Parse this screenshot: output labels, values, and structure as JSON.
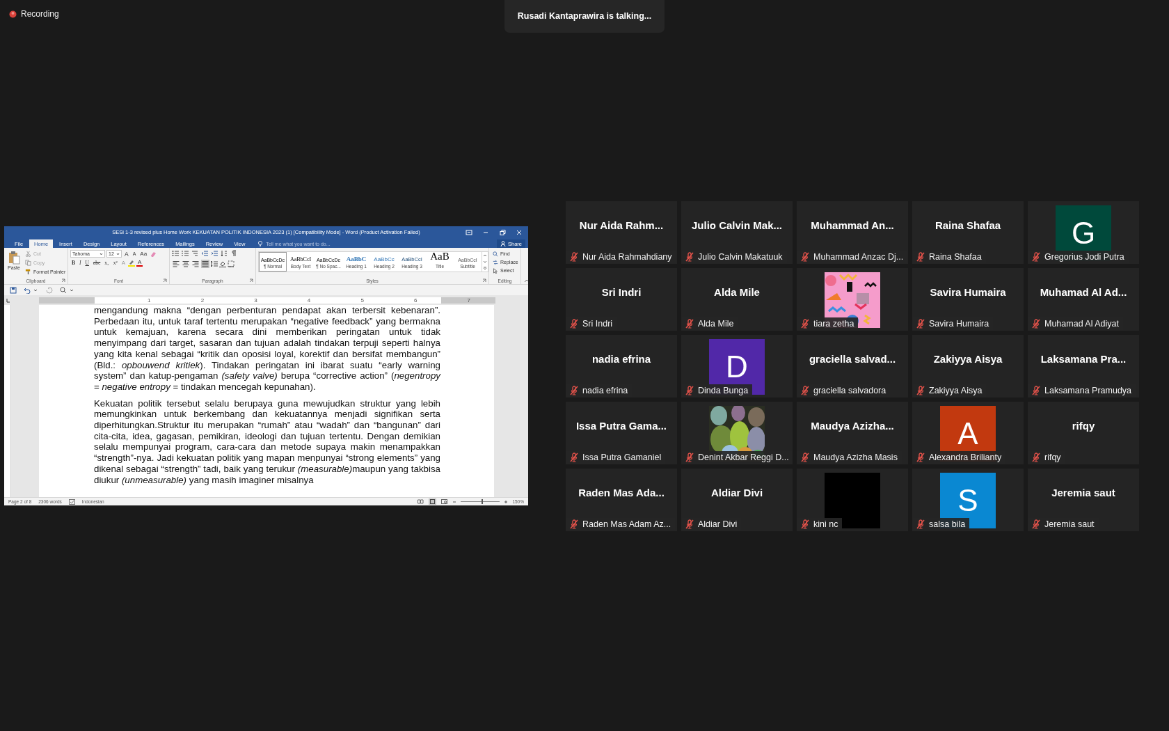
{
  "recording": {
    "label": "Recording"
  },
  "speaker_banner": {
    "text": "Rusadi Kantaprawira is talking..."
  },
  "shared_window": {
    "title": "SESi 1-3 revised plus Home Work  KEKUATAN POLITIK INDONESIA 2023 (1) [Compatibility Mode] - Word (Product Activation Failed)",
    "tabs": [
      {
        "label": "File",
        "selected": false
      },
      {
        "label": "Home",
        "selected": true
      },
      {
        "label": "Insert",
        "selected": false
      },
      {
        "label": "Design",
        "selected": false
      },
      {
        "label": "Layout",
        "selected": false
      },
      {
        "label": "References",
        "selected": false
      },
      {
        "label": "Mailings",
        "selected": false
      },
      {
        "label": "Review",
        "selected": false
      },
      {
        "label": "View",
        "selected": false
      }
    ],
    "tell_me": {
      "placeholder": "Tell me what you want to do..."
    },
    "share_button": "Share",
    "clipboard": {
      "label": "Clipboard",
      "paste": "Paste",
      "items": [
        {
          "kind": "cut",
          "label": "Cut",
          "disabled": true
        },
        {
          "kind": "copy",
          "label": "Copy",
          "disabled": true
        },
        {
          "kind": "painter",
          "label": "Format Painter",
          "disabled": false
        }
      ]
    },
    "font": {
      "label": "Font",
      "name": "Tahoma",
      "size": "12",
      "size_buttons": [
        "A",
        "A"
      ],
      "case_button": "Aa",
      "formats": [
        "B",
        "I",
        "U",
        "abc",
        "x₂",
        "x²"
      ],
      "effects_button": "A",
      "color_button": "A"
    },
    "paragraph": {
      "label": "Paragraph",
      "alignments": [
        {
          "kind": "left",
          "selected": false
        },
        {
          "kind": "center",
          "selected": false
        },
        {
          "kind": "right",
          "selected": false
        },
        {
          "kind": "justify",
          "selected": true
        }
      ]
    },
    "styles": {
      "label": "Styles",
      "items": [
        {
          "preview": "AaBbCcDc",
          "name": "¶ Normal",
          "kind": "normal",
          "selected": true
        },
        {
          "preview": "AaBbCcI",
          "name": "Body Text",
          "kind": "body",
          "selected": false
        },
        {
          "preview": "AaBbCcDc",
          "name": "¶ No Spac...",
          "kind": "normal",
          "selected": false
        },
        {
          "preview": "AaBbC",
          "name": "Heading 1",
          "kind": "heading1",
          "selected": false
        },
        {
          "preview": "AaBbCc",
          "name": "Heading 2",
          "kind": "heading2",
          "selected": false
        },
        {
          "preview": "AaBbCcI",
          "name": "Heading 3",
          "kind": "heading3",
          "selected": false
        },
        {
          "preview": "AaB",
          "name": "Title",
          "kind": "title",
          "selected": false
        },
        {
          "preview": "AaBbCcI",
          "name": "Subtitle",
          "kind": "subtitle",
          "selected": false
        }
      ]
    },
    "editing": {
      "label": "Editing",
      "items": [
        {
          "kind": "find",
          "label": "Find"
        },
        {
          "kind": "replace",
          "label": "Replace"
        },
        {
          "kind": "select",
          "label": "Select"
        }
      ]
    },
    "ruler": {
      "marks": [
        "1",
        "2",
        "3",
        "4",
        "5",
        "6",
        "7"
      ]
    },
    "document": {
      "paragraphs": [
        {
          "runs": [
            {
              "text": "mengandung makna “dengan perbenturan pendapat akan terbersit kebenaran”. Perbedaan itu, untuk taraf tertentu merupakan “negative feedback” yang bermakna untuk kemajuan, karena secara dini memberikan peringatan untuk tidak menyimpang dari target, sasaran dan tujuan adalah tindakan terpuji seperti halnya yang kita kenal sebagai “kritik dan oposisi loyal, korektif dan bersifat membangun” (Bld.: ",
              "italic": false
            },
            {
              "text": "opbouwend kritiek",
              "italic": true
            },
            {
              "text": "). Tindakan peringatan ini ibarat suatu “early warning system” dan katup-pengaman ",
              "italic": false
            },
            {
              "text": "(safety valve)",
              "italic": true
            },
            {
              "text": " berupa “corrective action” (",
              "italic": false
            },
            {
              "text": "negentropy",
              "italic": true
            },
            {
              "text": " = ",
              "italic": false
            },
            {
              "text": "negative entropy",
              "italic": true
            },
            {
              "text": " = tindakan mencegah kepunahan).",
              "italic": false
            }
          ]
        },
        {
          "runs": [
            {
              "text": "Kekuatan politik tersebut selalu berupaya guna mewujudkan struktur yang lebih memungkinkan untuk berkembang dan kekuatannya menjadi signifikan serta diperhitungkan.Struktur itu merupakan “rumah” atau “wadah” dan “bangunan” dari cita-cita, idea, gagasan, pemikiran, ideologi dan tujuan tertentu. Dengan demikian selalu mempunyai program, cara-cara dan metode supaya makin menampakkan “strength”-nya. Jadi kekuatan politik yang mapan menpunyai “strong elements” yang dikenal sebagai “strength” tadi, baik yang terukur ",
              "italic": false
            },
            {
              "text": "(measurable)",
              "italic": true
            },
            {
              "text": "maupun yang takbisa diukur ",
              "italic": false
            },
            {
              "text": "(unmeasurable)",
              "italic": true
            },
            {
              "text": " yang masih imaginer misalnya",
              "italic": false
            }
          ]
        }
      ]
    },
    "status_bar": {
      "page": "Page 2 of 8",
      "words": "2306 words",
      "language": "Indonesian",
      "views": [
        {
          "kind": "read",
          "selected": false
        },
        {
          "kind": "print",
          "selected": true
        },
        {
          "kind": "web",
          "selected": false
        }
      ],
      "zoom_slider": {
        "level": 0.55
      },
      "zoom": "150%"
    }
  },
  "participants": [
    {
      "kind": "name",
      "title": "Nur Aida Rahm...",
      "name": "Nur Aida Rahmahdiany",
      "muted": true
    },
    {
      "kind": "name",
      "title": "Julio Calvin Mak...",
      "name": "Julio Calvin Makatuuk",
      "muted": true
    },
    {
      "kind": "name",
      "title": "Muhammad An...",
      "name": "Muhammad Anzac Dj...",
      "muted": true
    },
    {
      "kind": "name",
      "title": "Raina Shafaa",
      "name": "Raina Shafaa",
      "muted": true
    },
    {
      "kind": "avatar",
      "initial": "G",
      "color": "#00493b",
      "name": "Gregorius Jodi Putra",
      "muted": true
    },
    {
      "kind": "name",
      "title": "Sri Indri",
      "name": "Sri Indri",
      "muted": true
    },
    {
      "kind": "name",
      "title": "Alda Mile",
      "name": "Alda Mile",
      "muted": true
    },
    {
      "kind": "picture",
      "name": "tiara zetha",
      "muted": true
    },
    {
      "kind": "name",
      "title": "Savira Humaira",
      "name": "Savira Humaira",
      "muted": true
    },
    {
      "kind": "name",
      "title": "Muhamad Al Ad...",
      "name": "Muhamad Al Adiyat",
      "muted": true
    },
    {
      "kind": "name",
      "title": "nadia efrina",
      "name": "nadia efrina",
      "muted": true
    },
    {
      "kind": "avatar",
      "initial": "D",
      "color": "#5128a8",
      "name": "Dinda Bunga",
      "muted": true
    },
    {
      "kind": "name",
      "title": "graciella salvad...",
      "name": "graciella salvadora",
      "muted": true
    },
    {
      "kind": "name",
      "title": "Zakiyya Aisya",
      "name": "Zakiyya Aisya",
      "muted": true
    },
    {
      "kind": "name",
      "title": "Laksamana Pra...",
      "name": "Laksamana Pramudya",
      "muted": true
    },
    {
      "kind": "name",
      "title": "Issa Putra Gama...",
      "name": "Issa Putra Gamaniel",
      "muted": true
    },
    {
      "kind": "picture",
      "name": "Denint Akbar Reggi D...",
      "muted": true
    },
    {
      "kind": "name",
      "title": "Maudya Azizha...",
      "name": "Maudya Azizha Masis",
      "muted": true
    },
    {
      "kind": "avatar",
      "initial": "A",
      "color": "#c2390f",
      "name": "Alexandra Brilianty",
      "muted": true
    },
    {
      "kind": "name",
      "title": "rifqy",
      "name": "rifqy",
      "muted": true
    },
    {
      "kind": "name",
      "title": "Raden Mas Ada...",
      "name": "Raden Mas Adam Az...",
      "muted": true
    },
    {
      "kind": "name",
      "title": "Aldiar Divi",
      "name": "Aldiar Divi",
      "muted": true
    },
    {
      "kind": "blank",
      "name": "kini nc",
      "muted": true
    },
    {
      "kind": "avatar",
      "initial": "S",
      "color": "#0a88d2",
      "name": "salsa bila",
      "muted": true
    },
    {
      "kind": "name",
      "title": "Jeremia saut",
      "name": "Jeremia saut",
      "muted": true
    }
  ]
}
